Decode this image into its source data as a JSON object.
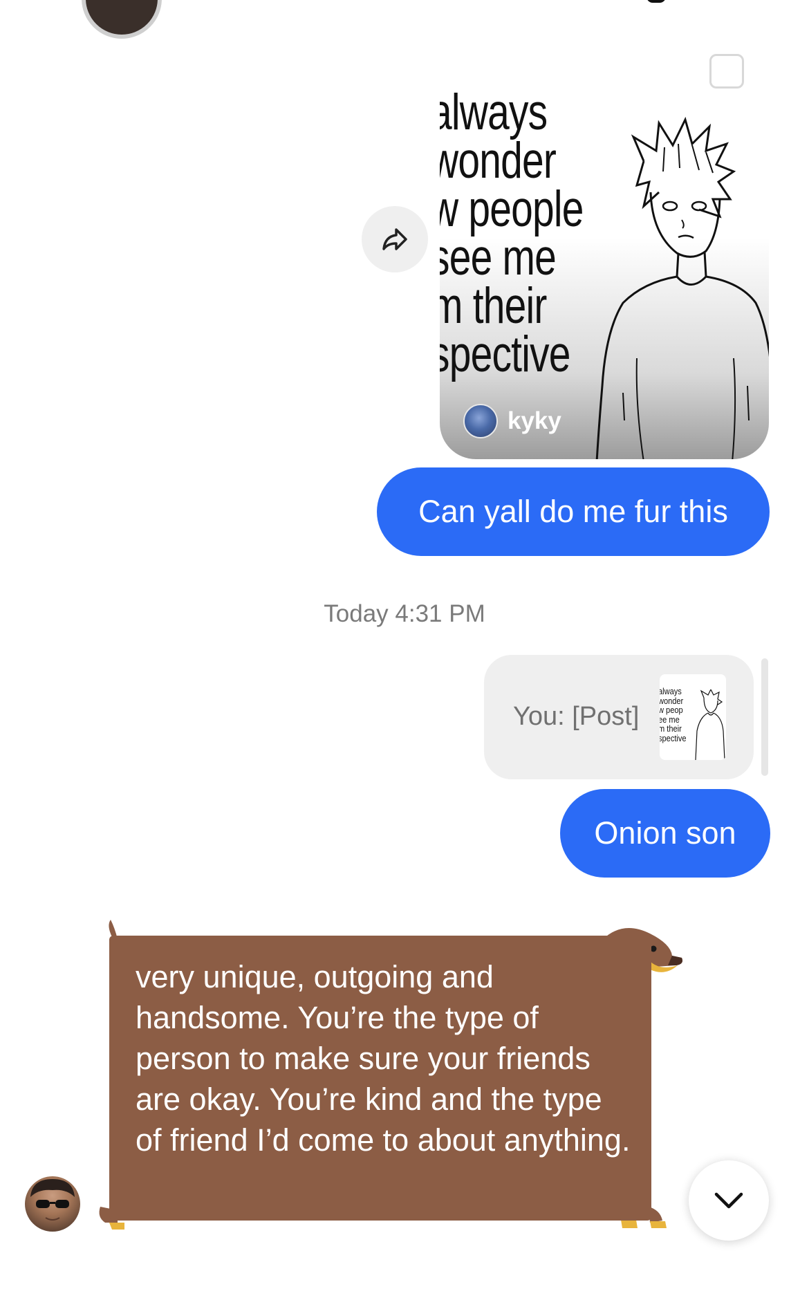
{
  "shared_post": {
    "caption_lines": [
      "always",
      "wonder",
      "w people",
      "see me",
      "m their",
      "spective"
    ],
    "author": "kyky"
  },
  "messages": [
    {
      "text": "Can yall do me fur this"
    },
    {
      "text": "Onion son"
    }
  ],
  "timestamp": "Today 4:31 PM",
  "reply_preview": {
    "text": "You: [Post]",
    "thumb_caption": "always\nwonder\nw peop\nee me\nm their\nspective"
  },
  "received_message": {
    "text": "very unique, outgoing and handsome. You’re the type of person to make sure your friends are okay. You’re kind and the type of friend I’d come to about anything."
  },
  "colors": {
    "outgoing_bubble": "#2b6bf6",
    "received_bubble": "#8c5d45",
    "reply_preview_bg": "#efefef"
  },
  "icons": {
    "share": "share-arrow-icon",
    "scroll_down": "chevron-down-icon"
  }
}
